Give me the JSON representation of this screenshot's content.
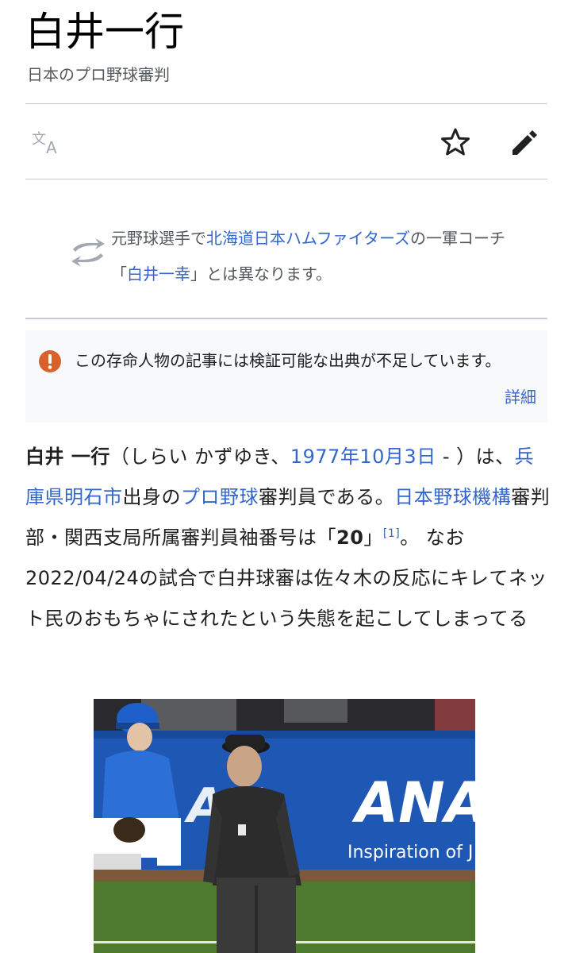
{
  "article": {
    "title": "白井一行",
    "subtitle": "日本のプロ野球審判"
  },
  "toolbar": {
    "language_icon": "translate-icon",
    "watch_icon": "star-icon",
    "edit_icon": "pencil-icon"
  },
  "hatnote": {
    "icon": "swap-icon",
    "text1": "元野球選手で",
    "link1": "北海道日本ハムファイターズ",
    "text2": "の一軍コーチ「",
    "link2": "白井一幸",
    "text3": "」とは異なります。"
  },
  "notice": {
    "icon": "exclamation-icon",
    "text": "この存命人物の記事には検証可能な出典が不足しています。",
    "more_label": "詳細"
  },
  "lead": {
    "name": "白井 一行",
    "reading": "（しらい かずゆき、",
    "birth_date": "1977年10月3日",
    "dash": " - ）は、",
    "birthplace": "兵庫県明石市",
    "t1": "出身の",
    "pro_baseball": "プロ野球",
    "t2": "審判員である。",
    "npb": "日本野球機構",
    "t3": "審判部・関西支局所属審判員袖番号は「",
    "number": "20",
    "t4": "」",
    "ref": "[1]",
    "t5": "。 なお2022/04/24の試合で白井球審は佐々木の反応にキレてネット民のおもちゃにされたという失態を起こしてしまってる"
  },
  "photo": {
    "banner_text": "ANA",
    "banner_sub": "Inspiration of J",
    "colors": {
      "wall": "#1f57b4",
      "grass": "#4e7a2f",
      "sky": "#2a2a2e"
    }
  },
  "colors": {
    "link": "#3366cc",
    "muted": "#54595d",
    "notice_bg": "#f8f9fa",
    "warning": "#dd3333"
  }
}
